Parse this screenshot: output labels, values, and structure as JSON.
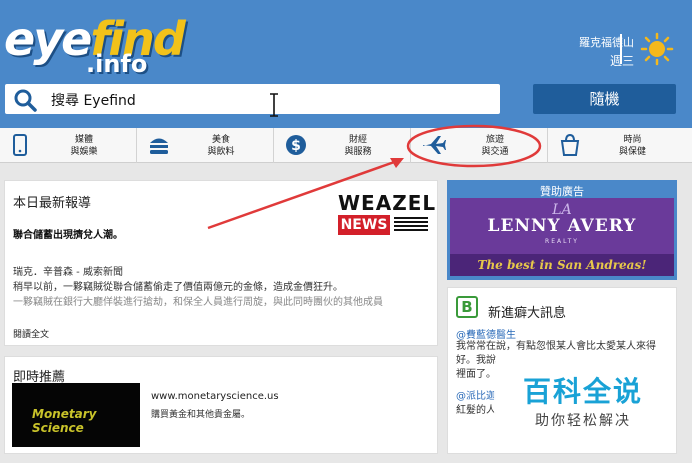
{
  "header": {
    "logo_main": "eye",
    "logo_accent": "find",
    "logo_domain": ".info",
    "location": "羅克福德山",
    "weekday": "週三",
    "weather_icon": "sun-icon"
  },
  "search": {
    "label": "搜尋 Eyefind",
    "random_label": "隨機"
  },
  "categories": [
    {
      "line1": "媒體",
      "line2": "與娛樂",
      "icon": "phone-icon"
    },
    {
      "line1": "美食",
      "line2": "與飲料",
      "icon": "burger-icon"
    },
    {
      "line1": "財經",
      "line2": "與服務",
      "icon": "dollar-icon"
    },
    {
      "line1": "旅遊",
      "line2": "與交通",
      "icon": "airplane-icon"
    },
    {
      "line1": "時尚",
      "line2": "與保健",
      "icon": "shopping-bag-icon"
    }
  ],
  "news": {
    "title": "本日最新報導",
    "headline": "聯合儲蓄出現擠兌人潮。",
    "byline": "瑞克．辛普森 - 威索新聞",
    "body1": "稍早以前，一夥竊賊從聯合儲蓄偷走了價值兩億元的金條，造成金價狂升。",
    "body2": "一夥竊賊在銀行大廳佯裝進行搶劫，和保全人員進行周旋，與此同時團伙的其他成員",
    "read_more": "閱讀全文",
    "logo_top": "WEAZEL",
    "logo_bottom": "NEWS"
  },
  "promo": {
    "title": "即時推薦",
    "thumb_text": "Monetary Science",
    "url": "www.monetaryscience.us",
    "desc": "購買黃金和其他貴金屬。"
  },
  "ad": {
    "label": "贊助廣告",
    "monogram": "LA",
    "name": "LENNY AVERY",
    "sub": "REALTY",
    "tagline": "The best in San Andreas!"
  },
  "bleeter": {
    "title": "新進癖大訊息",
    "user1": "@費藍德醫生",
    "text1": "我常常在說，有點忽恨某人會比太愛某人來得好。我說",
    "text1b": "裡面了。",
    "user2": "@派比迦",
    "text2": "紅髮的人"
  },
  "watermark": {
    "big": "百科全说",
    "small": "助你轻松解决"
  },
  "colors": {
    "header_blue": "#4a88c9",
    "button_blue": "#1f5d9b",
    "annotation_red": "#e03a3a",
    "ad_purple": "#6a3a9a"
  }
}
